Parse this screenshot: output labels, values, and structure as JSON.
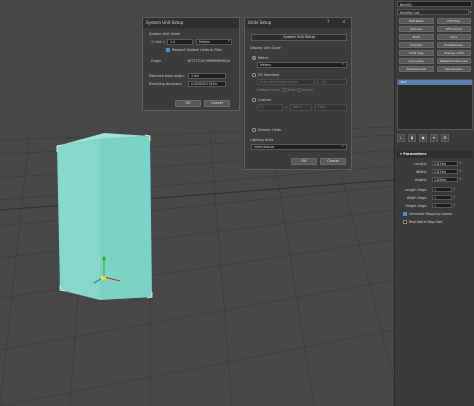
{
  "command_panel": {
    "object_name": "Box001",
    "modifier_list": "Modifier List",
    "modifier_buttons": [
      "Edit Mesh",
      "Edit Poly",
      "Extrude",
      "FFD 4x4x4",
      "Shell",
      "Slice",
      "Chamfer",
      "ProOptimizer",
      "UVW Map",
      "Unwrap UVW",
      "Symmetry",
      "Weighted Normals",
      "TurboSmooth",
      "OpenSubdiv"
    ],
    "stack_item": "Box",
    "params_title": "Parameters",
    "length_label": "Length:",
    "length_value": "0.813m",
    "width_label": "Width:",
    "width_value": "0.813m",
    "height_label": "Height:",
    "height_value": "2.850m",
    "length_segs_label": "Length Segs:",
    "length_segs_value": "1",
    "width_segs_label": "Width Segs:",
    "width_segs_value": "1",
    "height_segs_label": "Height Segs:",
    "height_segs_value": "1",
    "gen_mapping_label": "Generate Mapping Coords.",
    "real_world_label": "Real-World Map Size"
  },
  "system_dialog": {
    "title": "System Unit Setup",
    "scale_section": "System Unit Scale",
    "unit_prefix": "1 Unit =",
    "unit_value": "1.0",
    "unit_type": "Meters",
    "respect_label": "Respect System Units in Files",
    "origin_label": "Origin",
    "origin_value": "16777214.9999999981m",
    "distance_label": "Distance from origin:",
    "distance_value": "1.0m",
    "accuracy_label": "Resulting Accuracy:",
    "accuracy_value": "0.0000001192m",
    "ok": "OK",
    "cancel": "Cancel"
  },
  "units_dialog": {
    "title": "Units Setup",
    "help": "?",
    "close": "×",
    "system_button": "System Unit Setup",
    "display_section": "Display Unit Scale",
    "metric_label": "Metric",
    "metric_value": "Meters",
    "us_label": "US Standard",
    "us_value": "Feet w/Fractional Inches",
    "us_fraction": "1/8",
    "default_units_label": "Default Units:",
    "feet_label": "Feet",
    "inches_label": "Inches",
    "custom_label": "Custom",
    "custom_name": "FL",
    "custom_eq": "=",
    "custom_value": "660.0",
    "custom_unit": "Feet",
    "generic_label": "Generic Units",
    "lighting_label": "Lighting Units",
    "lighting_value": "International",
    "ok": "OK",
    "cancel": "Cancel"
  }
}
